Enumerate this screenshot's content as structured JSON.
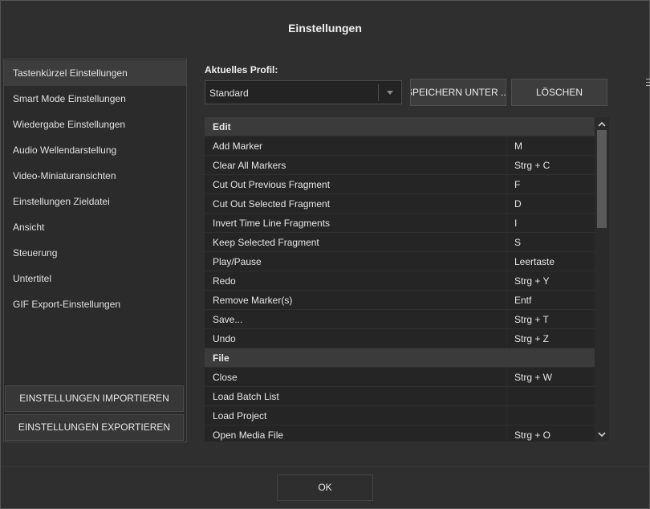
{
  "dialog": {
    "title": "Einstellungen"
  },
  "sidebar": {
    "items": [
      {
        "label": "Tastenkürzel Einstellungen",
        "selected": true
      },
      {
        "label": "Smart Mode Einstellungen"
      },
      {
        "label": "Wiedergabe Einstellungen"
      },
      {
        "label": "Audio Wellendarstellung"
      },
      {
        "label": "Video-Miniaturansichten"
      },
      {
        "label": "Einstellungen Zieldatei"
      },
      {
        "label": "Ansicht"
      },
      {
        "label": "Steuerung"
      },
      {
        "label": "Untertitel"
      },
      {
        "label": "GIF Export-Einstellungen"
      }
    ],
    "import_label": "EINSTELLUNGEN IMPORTIEREN",
    "export_label": "EINSTELLUNGEN EXPORTIEREN"
  },
  "profile": {
    "label": "Aktuelles Profil:",
    "value": "Standard",
    "save_as_label": "SPEICHERN UNTER ...",
    "delete_label": "LÖSCHEN"
  },
  "shortcuts": [
    {
      "type": "category",
      "name": "Edit"
    },
    {
      "name": "Add Marker",
      "key": "M"
    },
    {
      "name": "Clear All Markers",
      "key": "Strg + C"
    },
    {
      "name": "Cut Out Previous Fragment",
      "key": "F"
    },
    {
      "name": "Cut Out Selected Fragment",
      "key": "D"
    },
    {
      "name": "Invert Time Line Fragments",
      "key": "I"
    },
    {
      "name": "Keep Selected Fragment",
      "key": "S"
    },
    {
      "name": "Play/Pause",
      "key": "Leertaste"
    },
    {
      "name": "Redo",
      "key": "Strg + Y"
    },
    {
      "name": "Remove Marker(s)",
      "key": "Entf"
    },
    {
      "name": "Save...",
      "key": "Strg + T"
    },
    {
      "name": "Undo",
      "key": "Strg + Z"
    },
    {
      "type": "category",
      "name": "File"
    },
    {
      "name": "Close",
      "key": "Strg + W"
    },
    {
      "name": "Load Batch List",
      "key": ""
    },
    {
      "name": "Load Project",
      "key": ""
    },
    {
      "name": "Open Media File",
      "key": "Strg + O"
    }
  ],
  "footer": {
    "ok_label": "OK"
  }
}
